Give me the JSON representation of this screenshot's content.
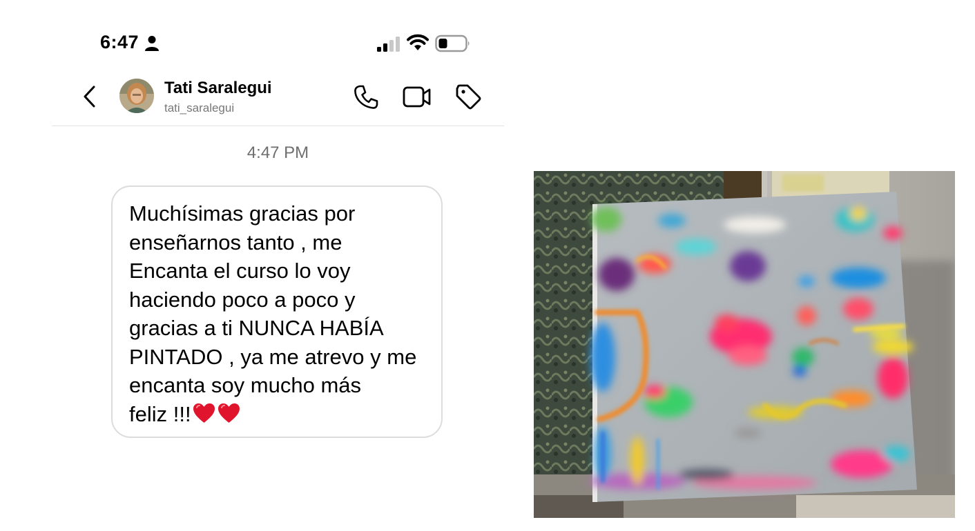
{
  "status_bar": {
    "time": "6:47",
    "icons": [
      "person-icon",
      "signal-icon",
      "wifi-icon",
      "battery-icon"
    ]
  },
  "header": {
    "contact_name": "Tati Saralegui",
    "contact_handle": "tati_saralegui",
    "icons": [
      "back-chevron-icon",
      "avatar",
      "phone-icon",
      "video-camera-icon",
      "tag-icon"
    ]
  },
  "conversation": {
    "timestamp": "4:47 PM",
    "message": {
      "text": "Muchísimas gracias por\nenseñarnos tanto , me\nEncanta el curso lo voy\nhaciendo poco a poco y\ngracias a ti NUNCA HABÍA\nPINTADO , ya me atrevo y me\nencanta soy mucho más\nfeliz !!!",
      "emoji": [
        "heart-icon",
        "heart-icon"
      ]
    }
  },
  "photo": {
    "subject": "abstract-painting-photo"
  },
  "colors": {
    "bubble_border": "#dcdcdc",
    "timestamp_text": "#6e6e6e",
    "handle_text": "#777777",
    "heart": "#e0142c",
    "divider": "#e2e2e2"
  }
}
